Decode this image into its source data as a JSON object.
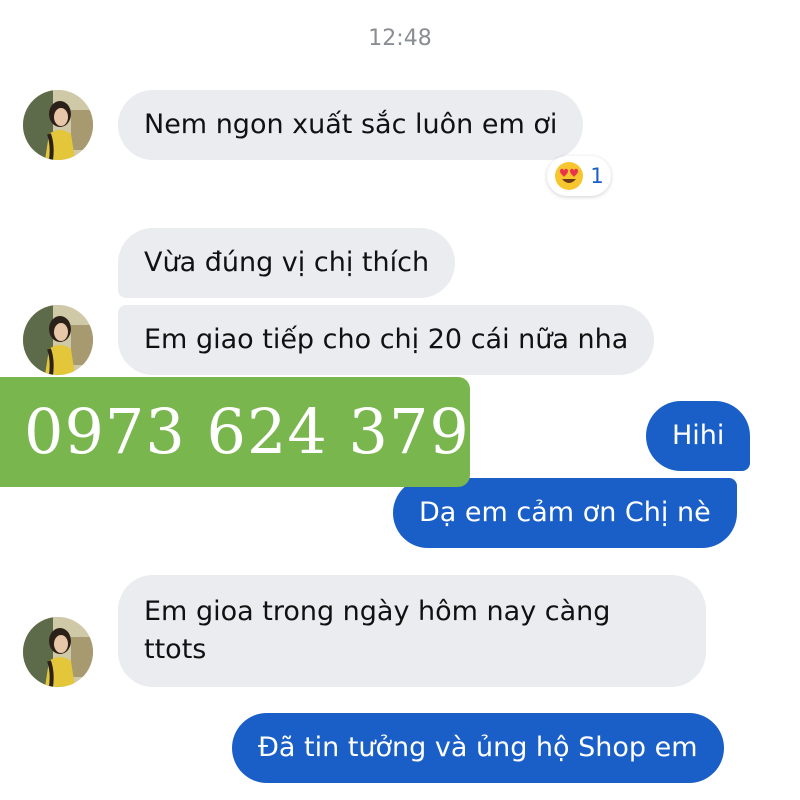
{
  "header": {
    "timestamp": "12:48"
  },
  "messages": [
    {
      "direction": "incoming",
      "text": "Nem ngon xuất sắc luôn em ơi"
    },
    {
      "direction": "incoming",
      "text": "Vừa đúng vị chị thích"
    },
    {
      "direction": "incoming",
      "text": "Em giao tiếp cho chị 20 cái nữa nha"
    },
    {
      "direction": "outgoing",
      "text": "Hihi"
    },
    {
      "direction": "outgoing",
      "text": "Dạ em cảm ơn Chị nè"
    },
    {
      "direction": "incoming",
      "lines": [
        "Em gioa trong ngày hôm nay càng",
        "ttots"
      ]
    },
    {
      "direction": "outgoing",
      "text": "Đã tin tưởng và ủng hộ Shop em"
    }
  ],
  "reaction": {
    "icon": "heart-eyes-emoji-icon",
    "count": "1"
  },
  "overlay": {
    "phone": "0973 624 379"
  },
  "colors": {
    "incoming_bubble": "#ebecf0",
    "outgoing_bubble": "#1a5fc8",
    "banner": "#79b64e",
    "timestamp": "#8a8d91"
  }
}
